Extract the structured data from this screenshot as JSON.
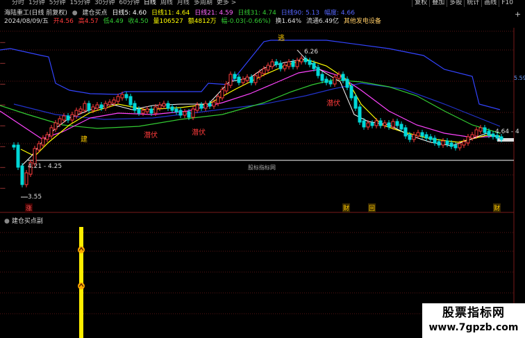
{
  "toolbar": {
    "tabs": [
      {
        "label": "分时",
        "active": false
      },
      {
        "label": "1分钟",
        "active": false
      },
      {
        "label": "5分钟",
        "active": false
      },
      {
        "label": "15分钟",
        "active": false
      },
      {
        "label": "30分钟",
        "active": false
      },
      {
        "label": "60分钟",
        "active": false
      },
      {
        "label": "日线",
        "active": true
      },
      {
        "label": "周线",
        "active": false
      },
      {
        "label": "月线",
        "active": false
      },
      {
        "label": "多周期",
        "active": false
      },
      {
        "label": "更多 >",
        "active": false
      }
    ],
    "right_buttons": [
      "复权",
      "叠加",
      "多股",
      "统计",
      "画线",
      "F10"
    ]
  },
  "info_line1": {
    "stock": "海陆重工(日线 前复权)",
    "indicator": "建仓买点",
    "ma5": "日线5: 4.60",
    "ma11": "日线11: 4.64",
    "ma21": "日线21: 4.59",
    "ma31": "日线31: 4.74",
    "ma_long": "日线90: 5.13",
    "extra": "幅度: 4.66"
  },
  "info_line2": {
    "date": "2024/08/09/五",
    "open": "开4.56",
    "high": "高4.57",
    "low": "低4.49",
    "close": "收4.50",
    "volume": "量106527",
    "amount": "额4812万",
    "change": "幅-0.03(-0.66%)",
    "turnover": "换1.64%",
    "float_cap": "流通6.49亿",
    "sector": "其他发电设备"
  },
  "labels": {
    "escape": "逃",
    "build1": "建",
    "lurk1": "潜伏",
    "lurk2": "潜伏",
    "lurk3": "潜伏",
    "peak_price": "6.26",
    "low_price": "3.55",
    "range_price": "4.21 - 4.25",
    "right_price": "4.64 - 4",
    "center_mark": "股标指标网",
    "right_axis_price": "5.59"
  },
  "bottom_markers": {
    "rise": "涨",
    "m1": "财",
    "m2": "回",
    "m3": "财"
  },
  "subpanel": {
    "title": "建仓买点副"
  },
  "watermark": {
    "line1": "股票指标网",
    "line2": "www.7gpzb.com"
  },
  "colors": {
    "up": "#ff3b3b",
    "down": "#00d8d8",
    "ma5": "#ffffff",
    "ma11": "#ffff00",
    "ma21": "#ff66ff",
    "ma31": "#33cc33",
    "ma_long": "#3344ff",
    "signal": "#ffee00"
  }
}
